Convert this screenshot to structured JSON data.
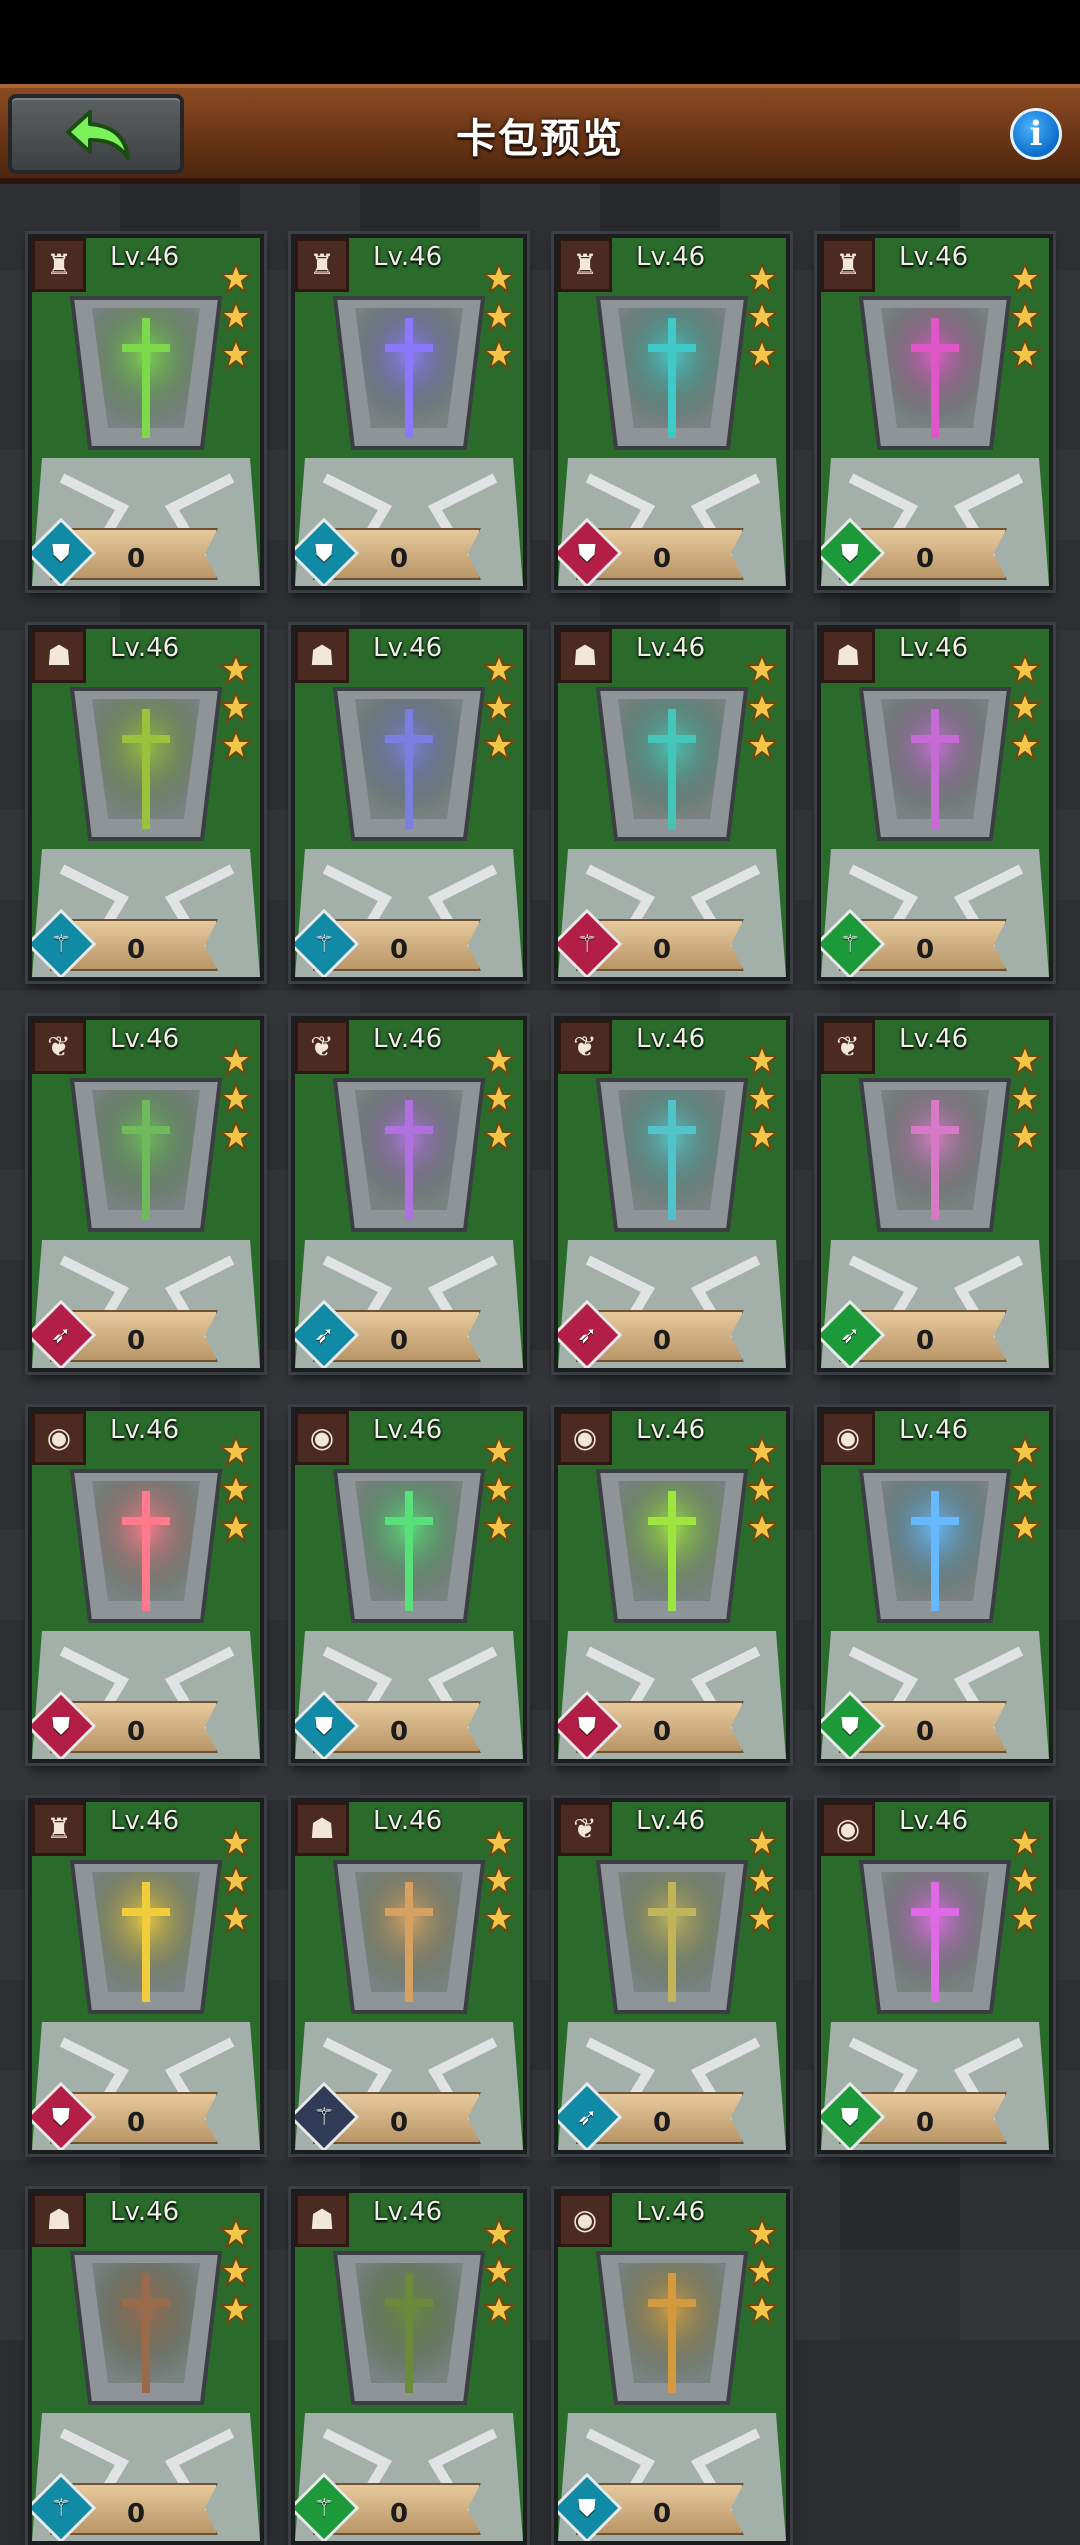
{
  "header": {
    "title": "卡包预览",
    "back_icon": "back-arrow-icon",
    "info_label": "i"
  },
  "colors": {
    "card_bg": "#2a6b2c",
    "gem_blue": "#118aa6",
    "gem_red": "#b21e46",
    "gem_green": "#1c9a3a",
    "gem_navy": "#303b58"
  },
  "cards": [
    {
      "class_icon": "helmet-icon",
      "level": "Lv.46",
      "count": "0",
      "role_icon": "shield-icon",
      "gem": "blue",
      "tint": "#7bd94a"
    },
    {
      "class_icon": "helmet-icon",
      "level": "Lv.46",
      "count": "0",
      "role_icon": "shield-icon",
      "gem": "blue",
      "tint": "#8b78ff"
    },
    {
      "class_icon": "helmet-icon",
      "level": "Lv.46",
      "count": "0",
      "role_icon": "shield-icon",
      "gem": "red",
      "tint": "#40c9c9"
    },
    {
      "class_icon": "helmet-icon",
      "level": "Lv.46",
      "count": "0",
      "role_icon": "shield-icon",
      "gem": "green",
      "tint": "#e056c8"
    },
    {
      "class_icon": "beast-icon",
      "level": "Lv.46",
      "count": "0",
      "role_icon": "staff-icon",
      "gem": "blue",
      "tint": "#9ac23b"
    },
    {
      "class_icon": "beast-icon",
      "level": "Lv.46",
      "count": "0",
      "role_icon": "staff-icon",
      "gem": "blue",
      "tint": "#7a7ee0"
    },
    {
      "class_icon": "beast-icon",
      "level": "Lv.46",
      "count": "0",
      "role_icon": "staff-icon",
      "gem": "red",
      "tint": "#45c6b8"
    },
    {
      "class_icon": "beast-icon",
      "level": "Lv.46",
      "count": "0",
      "role_icon": "staff-icon",
      "gem": "green",
      "tint": "#c66bd6"
    },
    {
      "class_icon": "wing-icon",
      "level": "Lv.46",
      "count": "0",
      "role_icon": "bow-icon",
      "gem": "red",
      "tint": "#6fbb5c"
    },
    {
      "class_icon": "wing-icon",
      "level": "Lv.46",
      "count": "0",
      "role_icon": "bow-icon",
      "gem": "blue",
      "tint": "#b070e0"
    },
    {
      "class_icon": "wing-icon",
      "level": "Lv.46",
      "count": "0",
      "role_icon": "bow-icon",
      "gem": "red",
      "tint": "#52c4c9"
    },
    {
      "class_icon": "wing-icon",
      "level": "Lv.46",
      "count": "0",
      "role_icon": "bow-icon",
      "gem": "green",
      "tint": "#d879c8"
    },
    {
      "class_icon": "eye-icon",
      "level": "Lv.46",
      "count": "0",
      "role_icon": "shield-icon",
      "gem": "red",
      "tint": "#ff7a8a"
    },
    {
      "class_icon": "eye-icon",
      "level": "Lv.46",
      "count": "0",
      "role_icon": "shield-icon",
      "gem": "blue",
      "tint": "#58e07a"
    },
    {
      "class_icon": "eye-icon",
      "level": "Lv.46",
      "count": "0",
      "role_icon": "shield-icon",
      "gem": "red",
      "tint": "#9ee63f"
    },
    {
      "class_icon": "eye-icon",
      "level": "Lv.46",
      "count": "0",
      "role_icon": "shield-icon",
      "gem": "green",
      "tint": "#66b8ff"
    },
    {
      "class_icon": "helmet-icon",
      "level": "Lv.46",
      "count": "0",
      "role_icon": "shield-icon",
      "gem": "red",
      "tint": "#f1cc3b"
    },
    {
      "class_icon": "beast-icon",
      "level": "Lv.46",
      "count": "0",
      "role_icon": "staff-icon",
      "gem": "navy",
      "tint": "#d7a261"
    },
    {
      "class_icon": "wing-icon",
      "level": "Lv.46",
      "count": "0",
      "role_icon": "bow-icon",
      "gem": "blue",
      "tint": "#c2b45a"
    },
    {
      "class_icon": "eye-icon",
      "level": "Lv.46",
      "count": "0",
      "role_icon": "shield-icon",
      "gem": "green",
      "tint": "#e06ae6"
    },
    {
      "class_icon": "beast-icon",
      "level": "Lv.46",
      "count": "0",
      "role_icon": "staff-icon",
      "gem": "blue",
      "tint": "#9b6a4a"
    },
    {
      "class_icon": "beast-icon",
      "level": "Lv.46",
      "count": "0",
      "role_icon": "staff-icon",
      "gem": "green",
      "tint": "#6b8a3a"
    },
    {
      "class_icon": "eye-icon",
      "level": "Lv.46",
      "count": "0",
      "role_icon": "shield-icon",
      "gem": "blue",
      "tint": "#d39b3d"
    }
  ]
}
